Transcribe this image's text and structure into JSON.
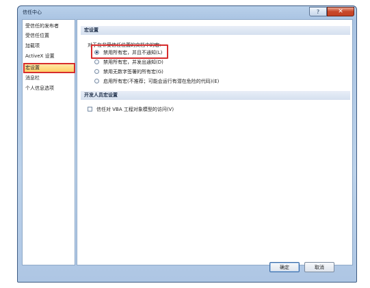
{
  "window": {
    "title": "信任中心",
    "help_glyph": "?",
    "close_glyph": "✕"
  },
  "sidebar": {
    "items": [
      {
        "label": "受信任的发布者",
        "selected": false
      },
      {
        "label": "受信任位置",
        "selected": false
      },
      {
        "label": "加载项",
        "selected": false
      },
      {
        "label": "ActiveX 设置",
        "selected": false
      },
      {
        "label": "宏设置",
        "selected": true
      },
      {
        "label": "消息栏",
        "selected": false
      },
      {
        "label": "个人信息选项",
        "selected": false
      }
    ]
  },
  "macro_settings": {
    "header": "宏设置",
    "description": "对于在非受信任位置的文档中的宏:",
    "options": [
      {
        "label": "禁用所有宏，并且不通知(L)",
        "selected": true
      },
      {
        "label": "禁用所有宏，并发出通知(D)",
        "selected": false
      },
      {
        "label": "禁用无数字签署的所有宏(G)",
        "selected": false
      },
      {
        "label": "启用所有宏(不推荐；可能会运行有潜在危险的代码)(E)",
        "selected": false
      }
    ]
  },
  "developer_macro_settings": {
    "header": "开发人员宏设置",
    "vba_checkbox": {
      "label": "信任对 VBA 工程对象模型的访问(V)",
      "checked": false
    }
  },
  "buttons": {
    "ok": "确定",
    "cancel": "取消"
  },
  "colors": {
    "highlight_red": "#d62c2c",
    "selected_item": "#ffd068",
    "titlebar_blue": "#b8d0ea"
  }
}
